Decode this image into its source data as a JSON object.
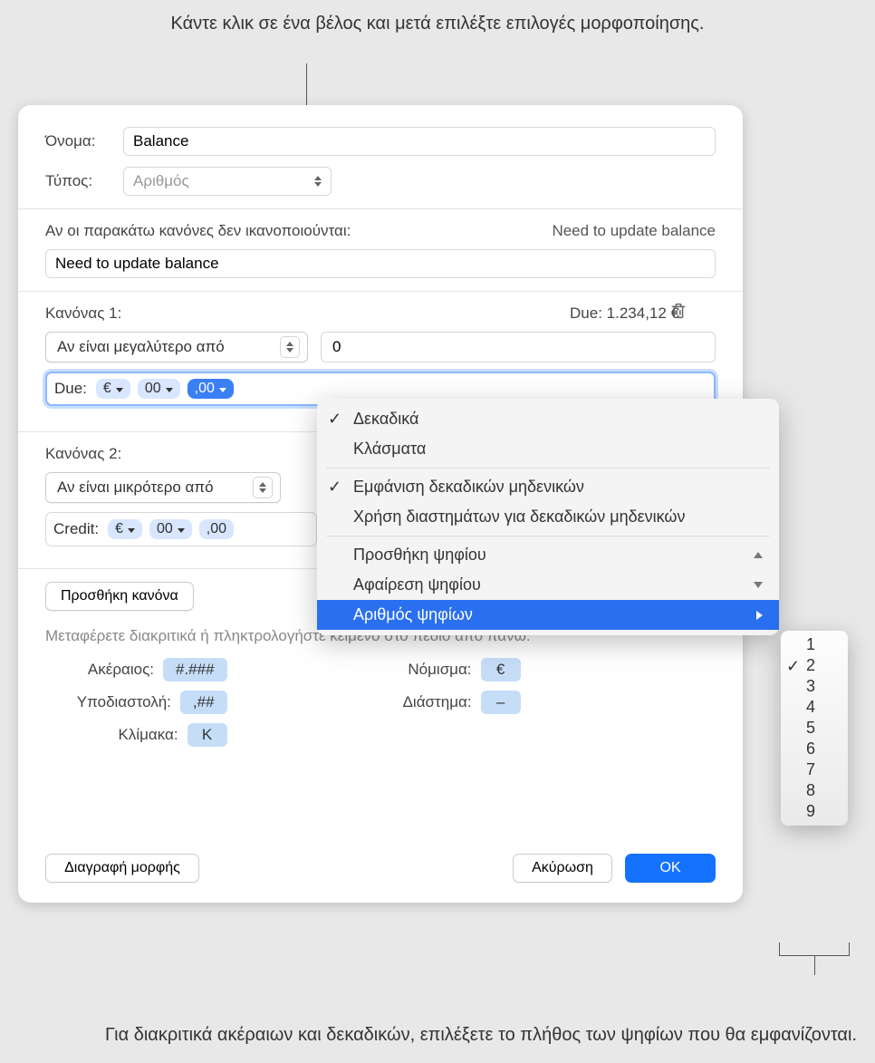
{
  "callouts": {
    "top": "Κάντε κλικ σε ένα βέλος και μετά επιλέξτε επιλογές μορφοποίησης.",
    "bottom": "Για διακριτικά ακέραιων και δεκαδικών, επιλέξετε το πλήθος των ψηφίων που θα εμφανίζονται."
  },
  "form": {
    "name_label": "Όνομα:",
    "name_value": "Balance",
    "type_label": "Τύπος:",
    "type_value": "Αριθμός"
  },
  "fallback": {
    "text": "Αν οι παρακάτω κανόνες δεν ικανοποιούνται:",
    "preview": "Need to update balance",
    "input_value": "Need to update balance"
  },
  "rule1": {
    "title": "Κανόνας 1:",
    "preview": "Due: 1.234,12 €",
    "op": "Αν είναι μεγαλύτερο από",
    "value": "0",
    "token_prefix": "Due:",
    "tok_currency": "€",
    "tok_int": "00",
    "tok_dec": ",00"
  },
  "rule2": {
    "title": "Κανόνας 2:",
    "op": "Αν είναι μικρότερο από",
    "token_prefix": "Credit:",
    "tok_currency": "€",
    "tok_int": "00",
    "tok_dec": ",00"
  },
  "add_rule": "Προσθήκη κανόνα",
  "help": "Μεταφέρετε διακριτικά ή πληκτρολογήστε κείμενο στο πεδίο από πάνω:",
  "tokens": {
    "integer_label": "Ακέραιος:",
    "integer": "#.###",
    "decimal_label": "Υποδιαστολή:",
    "decimal": ",##",
    "scale_label": "Κλίμακα:",
    "scale": "K",
    "currency_label": "Νόμισμα:",
    "currency": "€",
    "space_label": "Διάστημα:",
    "space": "–"
  },
  "footer": {
    "delete_format": "Διαγραφή μορφής",
    "cancel": "Ακύρωση",
    "ok": "OK"
  },
  "menu": {
    "decimals": "Δεκαδικά",
    "fractions": "Κλάσματα",
    "show_zeros": "Εμφάνιση δεκαδικών μηδενικών",
    "use_spaces": "Χρήση διαστημάτων για δεκαδικών μηδενικών",
    "add_digit": "Προσθήκη ψηφίου",
    "remove_digit": "Αφαίρεση ψηφίου",
    "digit_count": "Αριθμός ψηφίων"
  },
  "submenu": {
    "items": [
      "1",
      "2",
      "3",
      "4",
      "5",
      "6",
      "7",
      "8",
      "9"
    ],
    "selected_index": 1
  }
}
